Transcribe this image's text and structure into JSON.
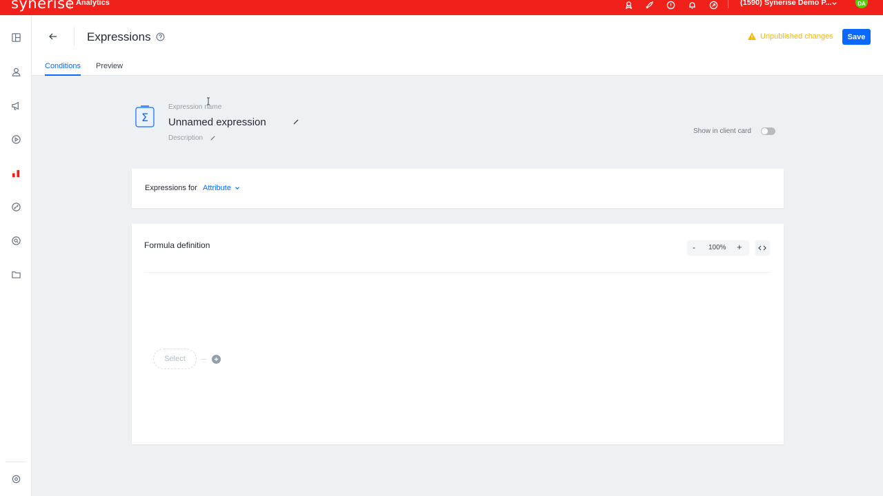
{
  "topbar": {
    "brand": "synerise",
    "module": "Analytics",
    "workspace": "(1590) Synerise Demo P...",
    "avatar_initials": "DA",
    "icons": [
      "badge-icon",
      "rocket-icon",
      "help-icon",
      "bell-icon",
      "sync-icon"
    ]
  },
  "sidebar": {
    "items": [
      "dashboard-icon",
      "user-icon",
      "megaphone-icon",
      "play-circle-icon",
      "analytics-icon",
      "exchange-icon",
      "search-circle-icon",
      "folder-icon"
    ],
    "active": "analytics-icon",
    "bottom": "settings-icon"
  },
  "header": {
    "title": "Expressions",
    "unpublished": "Unpublished changes",
    "save_label": "Save",
    "tabs": [
      {
        "label": "Conditions",
        "active": true
      },
      {
        "label": "Preview",
        "active": false
      }
    ]
  },
  "expression": {
    "name_label": "Expression name",
    "name": "Unnamed expression",
    "description_label": "Description",
    "client_card_label": "Show in client card",
    "client_card_enabled": false
  },
  "expressions_for": {
    "label": "Expressions for",
    "value": "Attribute"
  },
  "formula": {
    "title": "Formula definition",
    "zoom": "100%",
    "zoom_minus": "-",
    "zoom_plus": "+",
    "node_placeholder": "Select"
  },
  "colors": {
    "brand_red": "#f0201a",
    "primary_blue": "#0b68ff",
    "warning": "#fab700",
    "avatar_green": "#54cb0b"
  }
}
